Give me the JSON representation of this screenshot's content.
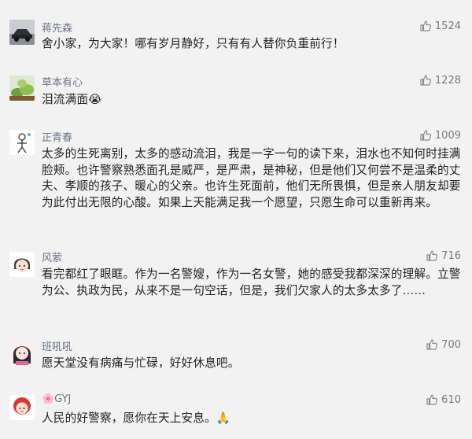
{
  "comments": [
    {
      "user": "蒋先森",
      "likes": "1524",
      "text": "舍小家，为大家！哪有岁月静好，只有有人替你负重前行！",
      "avatar": "car-photo-avatar"
    },
    {
      "user": "草本有心",
      "likes": "1228",
      "text": "泪流满面😭",
      "avatar": "plant-photo-avatar"
    },
    {
      "user": "正青春",
      "likes": "1009",
      "text": "太多的生死离别，太多的感动流泪，我是一字一句的读下来，泪水也不知何时挂满脸颊。也许警察熟悉面孔是威严，是严肃，是神秘，但是他们又何尝不是温柔的丈夫、孝顺的孩子、暖心的父亲。也许生死面前，他们无所畏惧，但是亲人朋友却要为此付出无限的心酸。如果上天能满足我一个愿望，只愿生命可以重新再来。",
      "avatar": "sketch-figure-avatar"
    },
    {
      "user": "风萦",
      "likes": "716",
      "text": "看完都红了眼眶。作为一名警嫂，作为一名女警，她的感受我都深深的理解。立警为公、执政为民，从来不是一句空话，但是，我们欠家人的太多太多了……",
      "avatar": "cartoon-girl-avatar"
    },
    {
      "user": "班吼吼",
      "likes": "700",
      "text": "愿天堂没有病痛与忙碌，好好休息吧。",
      "avatar": "anime-avatar"
    },
    {
      "user": "🌸GYJ",
      "likes": "610",
      "text": "人民的好警察，愿你在天上安息。🙏",
      "avatar": "red-hair-cartoon-avatar"
    }
  ],
  "icons": {
    "like": "thumbs-up-icon"
  },
  "colors": {
    "background": "#f2f2f2",
    "name": "#6b7486",
    "text": "#222222",
    "likes": "#7a7a7a"
  }
}
